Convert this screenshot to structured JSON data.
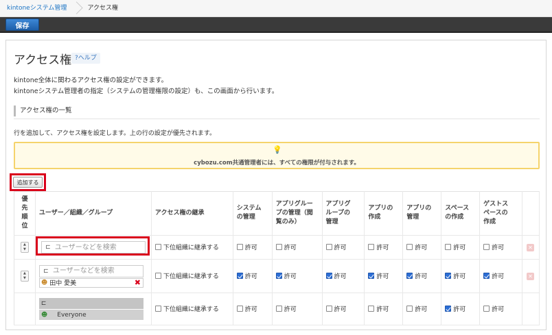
{
  "breadcrumb": {
    "root": "kintoneシステム管理",
    "current": "アクセス権"
  },
  "toolbar": {
    "save_label": "保存"
  },
  "page": {
    "title": "アクセス権",
    "help_label": "?ヘルプ",
    "description_line1": "kintone全体に関わるアクセス権の設定ができます。",
    "description_line2": "kintoneシステム管理者の指定（システムの管理権限の設定）も、この画面から行います。",
    "section_title": "アクセス権の一覧",
    "info_text": "行を追加して、アクセス権を設定します。上の行の設定が優先されます。",
    "notice_text": "cybozu.com共通管理者には、すべての権限が付与されます。",
    "add_button": "追加する"
  },
  "table": {
    "headers": {
      "priority": "優\n先\n順\n位",
      "user": "ユーザー／組織／グループ",
      "inherit": "アクセス権の継承",
      "sys_admin": "システム\nの管理",
      "app_admin_view": "アプリグルー\nプの管理（閲\n覧のみ）",
      "app_group": "アプリグ\nループの\n管理",
      "app_create": "アプリの\n作成",
      "app_manage": "アプリの\n管理",
      "space_create": "スペース\nの作成",
      "guest_space": "ゲストス\nペースの\n作成"
    },
    "search_placeholder": "ユーザーなどを検索",
    "inherit_label": "下位組織に継承する",
    "allow_label": "許可",
    "rows": [
      {
        "user_chip": "",
        "checks": [
          false,
          false,
          false,
          false,
          false,
          false,
          false
        ]
      },
      {
        "user_chip": "田中 愛美",
        "checks": [
          true,
          true,
          true,
          true,
          true,
          true,
          true
        ]
      },
      {
        "user_chip": "Everyone",
        "checks": [
          false,
          false,
          false,
          false,
          false,
          true,
          false
        ]
      }
    ]
  },
  "colors": {
    "accent": "#2c6ed5",
    "highlight": "#d9001b",
    "notice_bg": "#fffbe8",
    "notice_border": "#f5d36b"
  }
}
